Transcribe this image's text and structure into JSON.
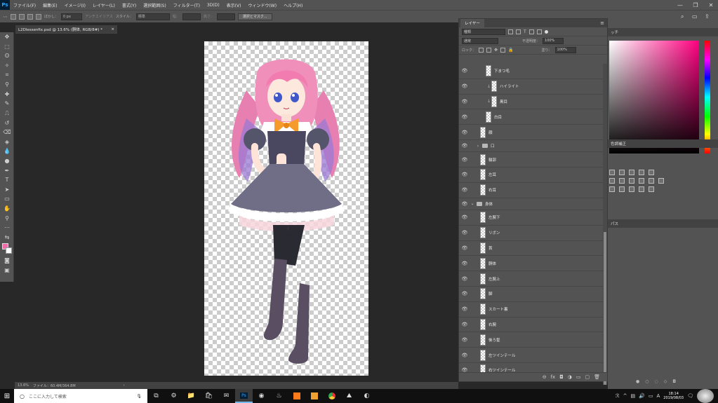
{
  "app": {
    "logo": "Ps"
  },
  "menubar": {
    "items": [
      "ファイル(F)",
      "編集(E)",
      "イメージ(I)",
      "レイヤー(L)",
      "書式(Y)",
      "選択範囲(S)",
      "フィルター(T)",
      "3D(D)",
      "表示(V)",
      "ウィンドウ(W)",
      "ヘルプ(H)"
    ],
    "window_controls": [
      "—",
      "❐",
      "✕"
    ]
  },
  "optionsbar": {
    "feather_label": "ぼかし：",
    "feather_value": "0 px",
    "antialias_label": "アンチエイリアス",
    "style_label": "スタイル：",
    "style_value": "標準",
    "width_label": "幅：",
    "height_label": "高さ：",
    "select_mask_button": "選択とマスク..."
  },
  "document": {
    "tab_title": "L2Dlessenfix.psd @ 13.6% (胴体, RGB/8#) *",
    "tab_close": "×"
  },
  "statusbar": {
    "zoom": "13.6%",
    "doc_info": "ファイル：60.4M/364.8M",
    "arrow": "›"
  },
  "layers_panel": {
    "tab_label": "レイヤー",
    "filter_kind": "種類",
    "blend_mode": "通常",
    "opacity_label": "不透明度：",
    "opacity_value": "100%",
    "lock_label": "ロック：",
    "fill_label": "塗り：",
    "fill_value": "100%",
    "layers": [
      {
        "name": "下まつ毛",
        "indent": 2,
        "clip": false,
        "group": false
      },
      {
        "name": "ハイライト",
        "indent": 3,
        "clip": true,
        "group": false
      },
      {
        "name": "黒目",
        "indent": 3,
        "clip": true,
        "group": false
      },
      {
        "name": "白目",
        "indent": 2,
        "clip": false,
        "group": false
      },
      {
        "name": "顔",
        "indent": 1,
        "clip": false,
        "group": false
      },
      {
        "name": "口",
        "indent": 1,
        "clip": false,
        "group": true,
        "open": false
      },
      {
        "name": "輪郭",
        "indent": 1,
        "clip": false,
        "group": false
      },
      {
        "name": "左耳",
        "indent": 1,
        "clip": false,
        "group": false
      },
      {
        "name": "右耳",
        "indent": 1,
        "clip": false,
        "group": false
      },
      {
        "name": "身体",
        "indent": 0,
        "clip": false,
        "group": true,
        "open": true
      },
      {
        "name": "左腕下",
        "indent": 1,
        "clip": false,
        "group": false
      },
      {
        "name": "リボン",
        "indent": 1,
        "clip": false,
        "group": false
      },
      {
        "name": "首",
        "indent": 1,
        "clip": false,
        "group": false
      },
      {
        "name": "胴体",
        "indent": 1,
        "clip": false,
        "group": false
      },
      {
        "name": "左腕上",
        "indent": 1,
        "clip": false,
        "group": false
      },
      {
        "name": "脚",
        "indent": 1,
        "clip": false,
        "group": false
      },
      {
        "name": "スカート裏",
        "indent": 1,
        "clip": false,
        "group": false
      },
      {
        "name": "右腕",
        "indent": 1,
        "clip": false,
        "group": false
      },
      {
        "name": "後ろ髪",
        "indent": 1,
        "clip": false,
        "group": false
      },
      {
        "name": "左ツインテール",
        "indent": 1,
        "clip": false,
        "group": false
      },
      {
        "name": "右ツインテール",
        "indent": 1,
        "clip": false,
        "group": false
      }
    ],
    "footer_icons": [
      "⊖",
      "fx",
      "◘",
      "◑",
      "▭",
      "▢",
      "🗑"
    ]
  },
  "rightdock": {
    "color_tab": "ッチ",
    "adjust_tab": "色調補正",
    "paths_tab": "パス",
    "accent_hue": "#ff0080"
  },
  "taskbar": {
    "search_placeholder": "ここに入力して検索",
    "time": "18:14",
    "date": "2019/08/03",
    "ime": "A"
  }
}
